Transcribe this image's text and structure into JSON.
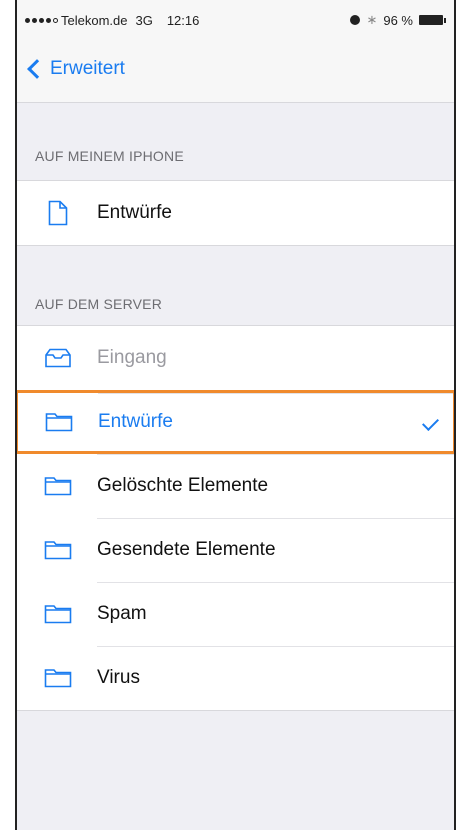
{
  "status_bar": {
    "carrier": "Telekom.de",
    "network": "3G",
    "time": "12:16",
    "battery": "96 %"
  },
  "nav": {
    "back_label": "Erweitert"
  },
  "sections": {
    "local": {
      "header": "AUF MEINEM IPHONE",
      "items": [
        {
          "label": "Entwürfe",
          "icon": "document-icon"
        }
      ]
    },
    "server": {
      "header": "AUF DEM SERVER",
      "items": [
        {
          "label": "Eingang",
          "icon": "inbox-tray-icon",
          "disabled": true
        },
        {
          "label": "Entwürfe",
          "icon": "folder-icon",
          "selected": true
        },
        {
          "label": "Gelöschte Elemente",
          "icon": "folder-icon"
        },
        {
          "label": "Gesendete Elemente",
          "icon": "folder-icon"
        },
        {
          "label": "Spam",
          "icon": "folder-icon"
        },
        {
          "label": "Virus",
          "icon": "folder-icon"
        }
      ]
    }
  },
  "colors": {
    "accent": "#1a7cf0",
    "selection_highlight": "#f08a2c",
    "background": "#efeff4"
  }
}
